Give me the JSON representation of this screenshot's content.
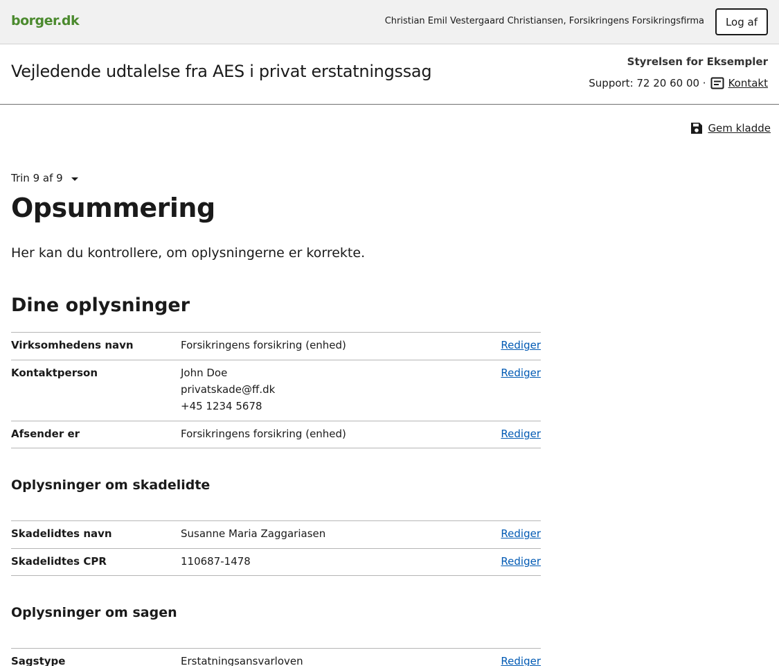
{
  "topbar": {
    "logo": "borger.dk",
    "user": "Christian Emil Vestergaard Christiansen, Forsikringens Forsikringsfirma",
    "logout_label": "Log af"
  },
  "header": {
    "title": "Vejledende udtalelse fra AES i privat erstatningssag",
    "authority": "Styrelsen for Eksempler",
    "support_text": "Support: 72 20 60 00 ·",
    "contact_label": "Kontakt"
  },
  "save_draft_label": "Gem kladde",
  "step": {
    "label": "Trin 9 af 9"
  },
  "main": {
    "heading": "Opsummering",
    "intro": "Her kan du kontrollere, om oplysningerne er korrekte.",
    "section_heading": "Dine oplysninger"
  },
  "edit_label": "Rediger",
  "dine_oplysninger": [
    {
      "label": "Virksomhedens navn",
      "value": "Forsikringens forsikring (enhed)"
    },
    {
      "label": "Kontaktperson",
      "value": "John Doe",
      "value2": "privatskade@ff.dk",
      "value3": "+45 1234 5678"
    },
    {
      "label": "Afsender er",
      "value": "Forsikringens forsikring (enhed)"
    }
  ],
  "skadelidte": {
    "heading": "Oplysninger om skadelidte",
    "rows": [
      {
        "label": "Skadelidtes navn",
        "value": "Susanne Maria Zaggariasen"
      },
      {
        "label": "Skadelidtes CPR",
        "value": "110687-1478"
      }
    ]
  },
  "sagen": {
    "heading": "Oplysninger om sagen",
    "rows": [
      {
        "label": "Sagstype",
        "value": "Erstatningsansvarloven"
      }
    ]
  }
}
